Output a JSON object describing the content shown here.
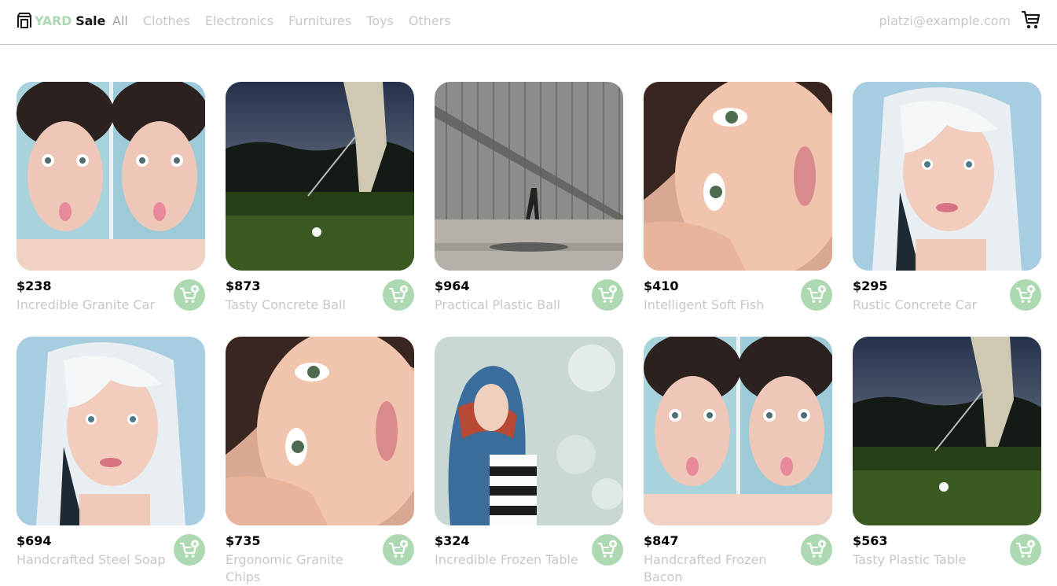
{
  "logo": {
    "part1": "YARD",
    "part2": "Sale",
    "icon": "storefront-icon",
    "accent": "#ACD9B2"
  },
  "nav": {
    "links": [
      "All",
      "Clothes",
      "Electronics",
      "Furnitures",
      "Toys",
      "Others"
    ],
    "email": "platzi@example.com",
    "cart_icon": "shopping-cart-icon"
  },
  "products": [
    {
      "price": "$238",
      "name": "Incredible Granite Car",
      "image": "portrait-split"
    },
    {
      "price": "$873",
      "name": "Tasty Concrete Ball",
      "image": "golf"
    },
    {
      "price": "$964",
      "name": "Practical Plastic Ball",
      "image": "street"
    },
    {
      "price": "$410",
      "name": "Intelligent Soft Fish",
      "image": "portrait-lying"
    },
    {
      "price": "$295",
      "name": "Rustic Concrete Car",
      "image": "portrait-blonde"
    },
    {
      "price": "$694",
      "name": "Handcrafted Steel Soap",
      "image": "portrait-blonde"
    },
    {
      "price": "$735",
      "name": "Ergonomic Granite Chips",
      "image": "portrait-lying"
    },
    {
      "price": "$324",
      "name": "Incredible Frozen Table",
      "image": "portrait-scarf"
    },
    {
      "price": "$847",
      "name": "Handcrafted Frozen Bacon",
      "image": "portrait-split"
    },
    {
      "price": "$563",
      "name": "Tasty Plastic Table",
      "image": "golf"
    }
  ],
  "add_to_cart_icon": "add-to-cart-icon",
  "colors": {
    "accent": "#ACD9B2",
    "muted_text": "#C7C7C7",
    "divider": "#C7C7C7"
  }
}
